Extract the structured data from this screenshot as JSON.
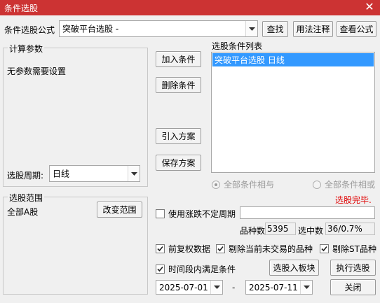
{
  "window": {
    "title": "条件选股",
    "close_glyph": "✕"
  },
  "formula": {
    "label": "条件选股公式",
    "value": "突破平台选股 -",
    "find_btn": "查找",
    "usage_btn": "用法注释",
    "view_btn": "查看公式"
  },
  "params": {
    "title": "计算参数",
    "none_text": "无参数需要设置",
    "period_label": "选股周期:",
    "period_value": "日线"
  },
  "condition_buttons": {
    "add": "加入条件",
    "delete": "删除条件",
    "import": "引入方案",
    "save": "保存方案"
  },
  "condition_list": {
    "title": "选股条件列表",
    "items": [
      "突破平台选股  日线"
    ]
  },
  "logic": {
    "all_and": "全部条件相与",
    "all_or": "全部条件相或"
  },
  "status": "选股完毕.",
  "scope": {
    "title": "选股范围",
    "value": "全部A股",
    "change_btn": "改变范围"
  },
  "options": {
    "irregular_period": "使用涨跌不定周期",
    "count_label": "品种数",
    "count_value": "5395",
    "selected_label": "选中数",
    "selected_value": "36/0.7%",
    "forward_adj": "前复权数据",
    "exclude_untraded": "剔除当前未交易的品种",
    "exclude_st": "剔除ST品种",
    "time_range": "时间段内满足条件"
  },
  "actions": {
    "to_block": "选股入板块",
    "execute": "执行选股",
    "close": "关闭"
  },
  "dates": {
    "start": "2025-07-01",
    "separator": "-",
    "end": "2025-07-11"
  }
}
